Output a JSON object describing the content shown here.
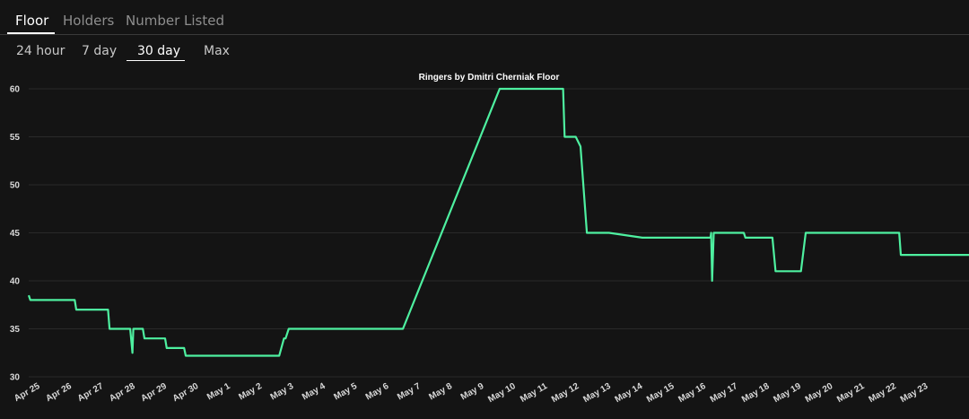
{
  "tabs": [
    {
      "label": "Floor",
      "active": true
    },
    {
      "label": "Holders",
      "active": false
    },
    {
      "label": "Number Listed",
      "active": false
    }
  ],
  "ranges": [
    {
      "label": "24 hour",
      "active": false
    },
    {
      "label": "7 day",
      "active": false
    },
    {
      "label": "30 day",
      "active": true
    },
    {
      "label": "Max",
      "active": false
    }
  ],
  "colors": {
    "background": "#141414",
    "line": "#4ef0a0",
    "grid": "#2a2a2a"
  },
  "chart_data": {
    "type": "line",
    "title": "Ringers by Dmitri Cherniak Floor",
    "xlabel": "",
    "ylabel": "",
    "ylim": [
      30,
      60
    ],
    "yticks": [
      30,
      35,
      40,
      45,
      50,
      55,
      60
    ],
    "xlim": [
      0,
      29.65
    ],
    "xticks": [
      "Apr 25",
      "Apr 26",
      "Apr 27",
      "Apr 28",
      "Apr 29",
      "Apr 30",
      "May 1",
      "May 2",
      "May 3",
      "May 4",
      "May 5",
      "May 6",
      "May 7",
      "May 8",
      "May 9",
      "May 10",
      "May 11",
      "May 12",
      "May 13",
      "May 14",
      "May 15",
      "May 16",
      "May 17",
      "May 18",
      "May 19",
      "May 20",
      "May 21",
      "May 22",
      "May 23"
    ],
    "grid": "horizontal",
    "series": [
      {
        "x": [
          0,
          0.05,
          0.1,
          1.45,
          1.5,
          2.5,
          2.55,
          3.2,
          3.27,
          3.3,
          3.37,
          3.6,
          3.65,
          4.3,
          4.35,
          4.9,
          4.95,
          7.9,
          8.05,
          8.1,
          8.2,
          11.8,
          14.85,
          16.85,
          16.9,
          17.25,
          17.4,
          17.6,
          18.0,
          18.2,
          18.3,
          19.35,
          19.4,
          21.5,
          21.52,
          21.55,
          21.6,
          21.65,
          22.55,
          22.6,
          23.45,
          23.55,
          24.35,
          24.5,
          27.45,
          27.5,
          29.65
        ],
        "values": [
          38.5,
          38.0,
          38.0,
          38.0,
          37.0,
          37.0,
          35.0,
          35.0,
          32.5,
          35.0,
          35.0,
          35.0,
          34.0,
          34.0,
          33.0,
          33.0,
          32.2,
          32.2,
          34.0,
          34.0,
          35.0,
          35.0,
          60.0,
          60.0,
          55.0,
          55.0,
          54.0,
          45.0,
          45.0,
          45.0,
          45.0,
          44.5,
          44.5,
          44.5,
          45.0,
          40.0,
          45.0,
          45.0,
          45.0,
          44.5,
          44.5,
          41.0,
          41.0,
          45.0,
          45.0,
          42.7,
          42.7
        ]
      }
    ]
  }
}
